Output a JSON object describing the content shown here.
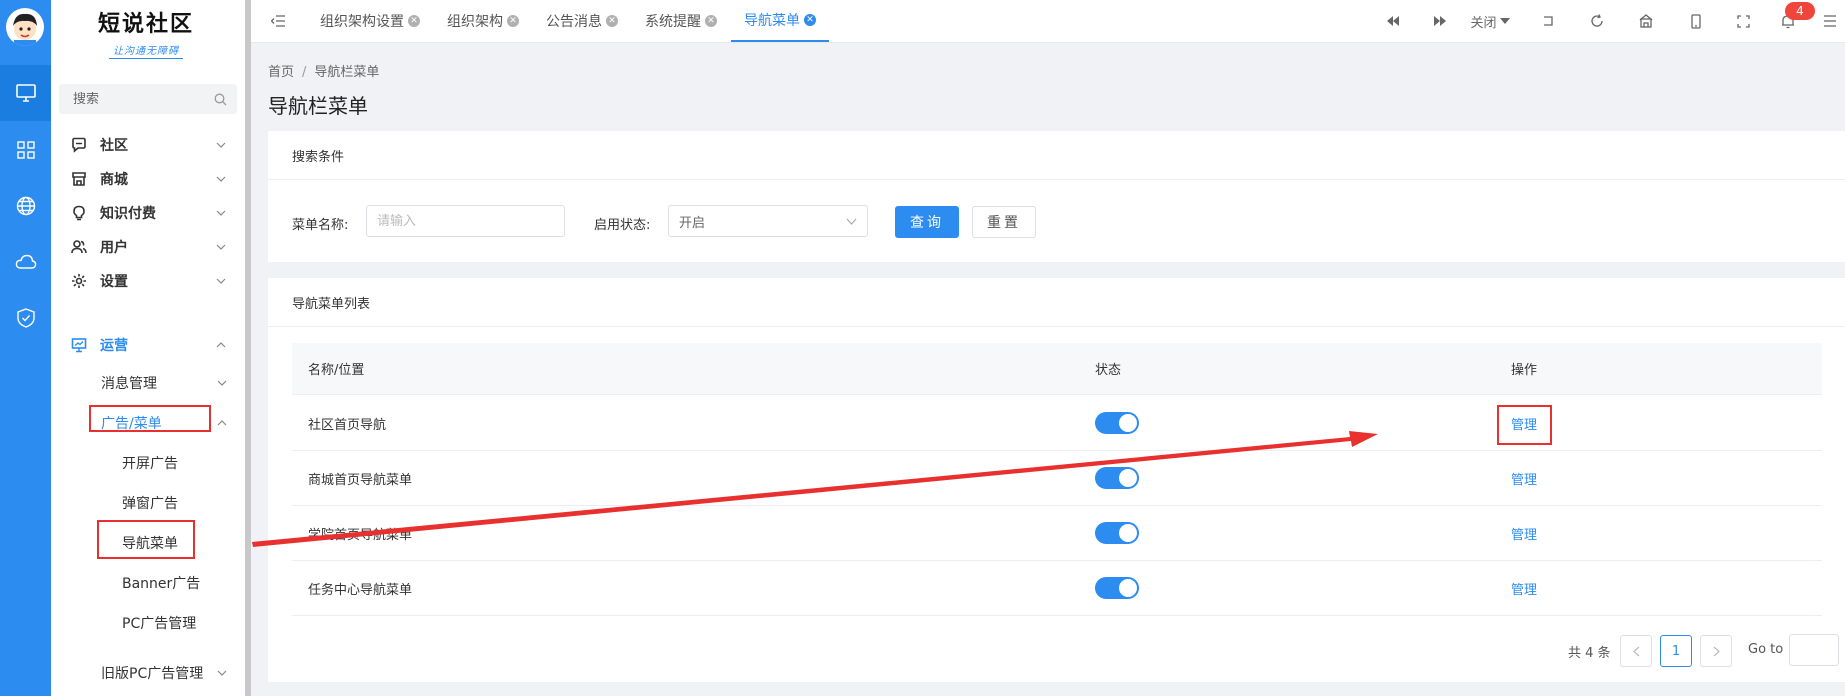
{
  "sidebar": {
    "logo_title": "短说社区",
    "logo_slogan": "让沟通无障碍",
    "search_placeholder": "搜索",
    "menu": [
      {
        "label": "社区"
      },
      {
        "label": "商城"
      },
      {
        "label": "知识付费"
      },
      {
        "label": "用户"
      },
      {
        "label": "设置"
      },
      {
        "label": "运营"
      }
    ],
    "submenu": [
      {
        "label": "消息管理"
      },
      {
        "label": "广告/菜单"
      }
    ],
    "leaves": [
      {
        "label": "开屏广告"
      },
      {
        "label": "弹窗广告"
      },
      {
        "label": "导航菜单"
      },
      {
        "label": "Banner广告"
      },
      {
        "label": "PC广告管理"
      }
    ],
    "legacy": {
      "label": "旧版PC广告管理"
    }
  },
  "topbar": {
    "tabs": [
      {
        "label": "组织架构设置"
      },
      {
        "label": "组织架构"
      },
      {
        "label": "公告消息"
      },
      {
        "label": "系统提醒"
      },
      {
        "label": "导航菜单"
      }
    ],
    "close_label": "关闭",
    "notification_count": "4"
  },
  "breadcrumb": {
    "home": "首页",
    "current": "导航栏菜单"
  },
  "page_title": "导航栏菜单",
  "search_card": {
    "title": "搜索条件",
    "name_label": "菜单名称:",
    "name_placeholder": "请输入",
    "status_label": "启用状态:",
    "status_value": "开启",
    "query_button": "查询",
    "reset_button": "重置"
  },
  "list_card": {
    "title": "导航菜单列表",
    "columns": {
      "name": "名称/位置",
      "status": "状态",
      "action": "操作"
    },
    "rows": [
      {
        "name": "社区首页导航",
        "enabled": true,
        "action": "管理"
      },
      {
        "name": "商城首页导航菜单",
        "enabled": true,
        "action": "管理"
      },
      {
        "name": "学院首页导航菜单",
        "enabled": true,
        "action": "管理"
      },
      {
        "name": "任务中心导航菜单",
        "enabled": true,
        "action": "管理"
      }
    ]
  },
  "pagination": {
    "total_text": "共 4 条",
    "current_page": "1",
    "goto_label": "Go to"
  },
  "colors": {
    "primary": "#2d8cf0",
    "annotation": "#e8312f",
    "badge": "#f0453a"
  }
}
